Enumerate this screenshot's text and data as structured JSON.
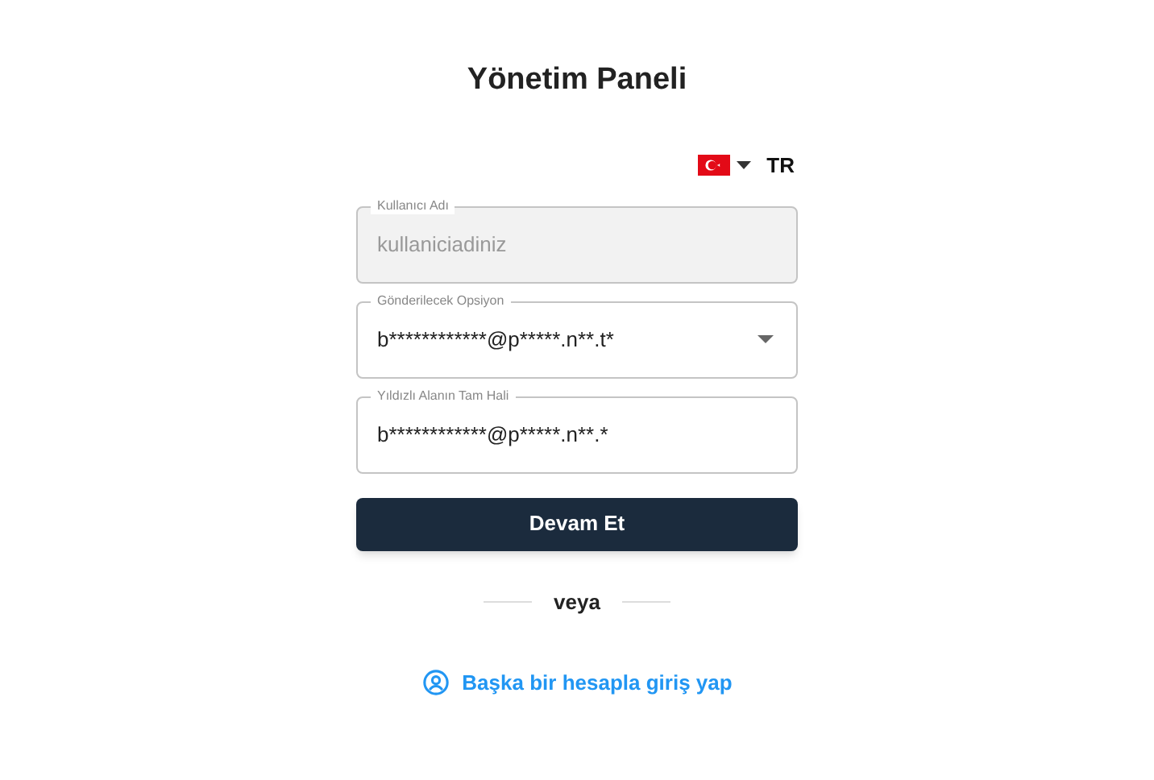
{
  "title": "Yönetim Paneli",
  "language": {
    "code": "TR"
  },
  "fields": [
    {
      "kind": "text",
      "label": "Kullanıcı Adı",
      "value": "kullaniciadiniz",
      "disabled": true
    },
    {
      "kind": "select",
      "label": "Gönderilecek Opsiyon",
      "value": "b************@p*****.n**.t*",
      "disabled": false
    },
    {
      "kind": "text",
      "label": "Yıldızlı Alanın Tam Hali",
      "value": "b************@p*****.n**.*",
      "disabled": false
    }
  ],
  "submit": "Devam Et",
  "divider": "veya",
  "alt_login": "Başka bir hesapla giriş yap"
}
